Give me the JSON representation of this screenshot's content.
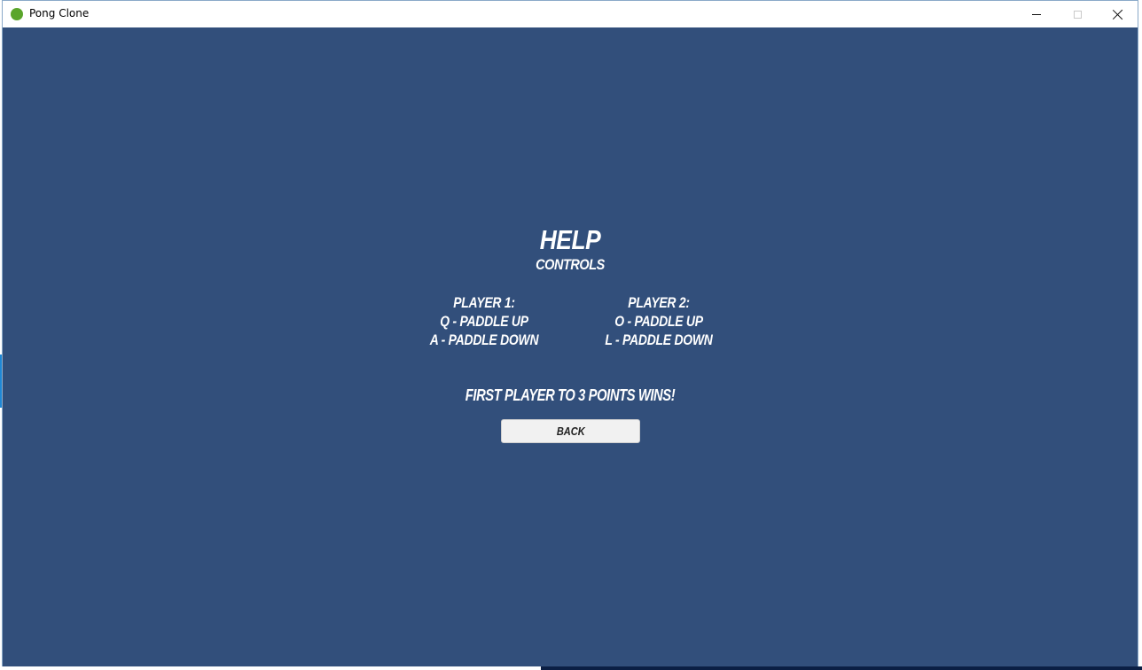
{
  "window": {
    "title": "Pong Clone",
    "icon": "green-circle-app-icon",
    "controls": [
      "minimize-icon",
      "maximize-icon",
      "close-icon"
    ]
  },
  "colors": {
    "background": "#324f7b",
    "text": "#ffffff",
    "button_bg": "#f1f1f1",
    "app_icon": "#5aa52b"
  },
  "help": {
    "title": "HELP",
    "subtitle": "CONTROLS",
    "player1": {
      "heading": "PLAYER 1:",
      "up": "Q - PADDLE UP",
      "down": "A - PADDLE DOWN"
    },
    "player2": {
      "heading": "PLAYER 2:",
      "up": "O - PADDLE UP",
      "down": "L - PADDLE DOWN"
    },
    "win_message": "FIRST PLAYER TO 3 POINTS WINS!",
    "back_label": "BACK"
  }
}
